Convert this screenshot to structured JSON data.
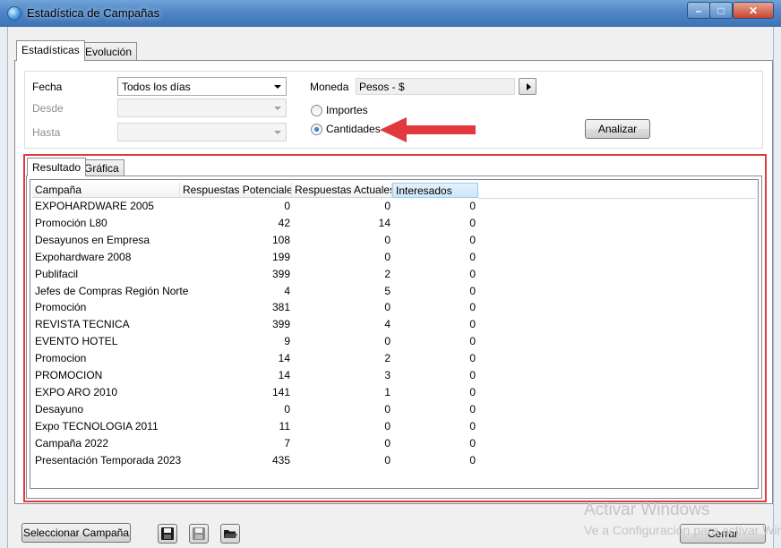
{
  "window": {
    "title": "Estadística de Campañas",
    "controls": {
      "minimize": "–",
      "maximize": "□",
      "close": "✕"
    }
  },
  "main_tabs": [
    {
      "label": "Estadísticas",
      "selected": true
    },
    {
      "label": "Evolución",
      "selected": false
    }
  ],
  "filters": {
    "fecha_label": "Fecha",
    "fecha_value": "Todos los días",
    "desde_label": "Desde",
    "desde_value": "",
    "hasta_label": "Hasta",
    "hasta_value": "",
    "moneda_label": "Moneda",
    "moneda_value": "Pesos - $",
    "option_importes": "Importes",
    "option_cantidades": "Cantidades",
    "selected_option": "Cantidades",
    "analizar_label": "Analizar"
  },
  "result_tabs": [
    {
      "label": "Resultado",
      "selected": true
    },
    {
      "label": "Gráfica",
      "selected": false
    }
  ],
  "table": {
    "columns": [
      "Campaña",
      "Respuestas Potenciales",
      "Respuestas Actuales",
      "Interesados"
    ],
    "rows": [
      [
        "EXPOHARDWARE 2005",
        "0",
        "0",
        "0"
      ],
      [
        "Promoción L80",
        "42",
        "14",
        "0"
      ],
      [
        "Desayunos en Empresa",
        "108",
        "0",
        "0"
      ],
      [
        "Expohardware 2008",
        "199",
        "0",
        "0"
      ],
      [
        "Publifacil",
        "399",
        "2",
        "0"
      ],
      [
        "Jefes de Compras Región Norte",
        "4",
        "5",
        "0"
      ],
      [
        "Promoción",
        "381",
        "0",
        "0"
      ],
      [
        "REVISTA TECNICA",
        "399",
        "4",
        "0"
      ],
      [
        "EVENTO HOTEL",
        "9",
        "0",
        "0"
      ],
      [
        "Promocion",
        "14",
        "2",
        "0"
      ],
      [
        "PROMOCION",
        "14",
        "3",
        "0"
      ],
      [
        "EXPO ARO 2010",
        "141",
        "1",
        "0"
      ],
      [
        "Desayuno",
        "0",
        "0",
        "0"
      ],
      [
        "Expo TECNOLOGIA 2011",
        "11",
        "0",
        "0"
      ],
      [
        "Campaña 2022",
        "7",
        "0",
        "0"
      ],
      [
        "Presentación Temporada 2023",
        "435",
        "0",
        "0"
      ]
    ]
  },
  "footer": {
    "select_campaign_label": "Seleccionar Campaña",
    "close_label": "Cerrar"
  },
  "watermark": {
    "line1": "Activar Windows",
    "line2": "Ve a Configuración para activar Windows."
  },
  "colors": {
    "annotation_red": "#e0393e",
    "titlebar_blue": "#4f86c6"
  }
}
